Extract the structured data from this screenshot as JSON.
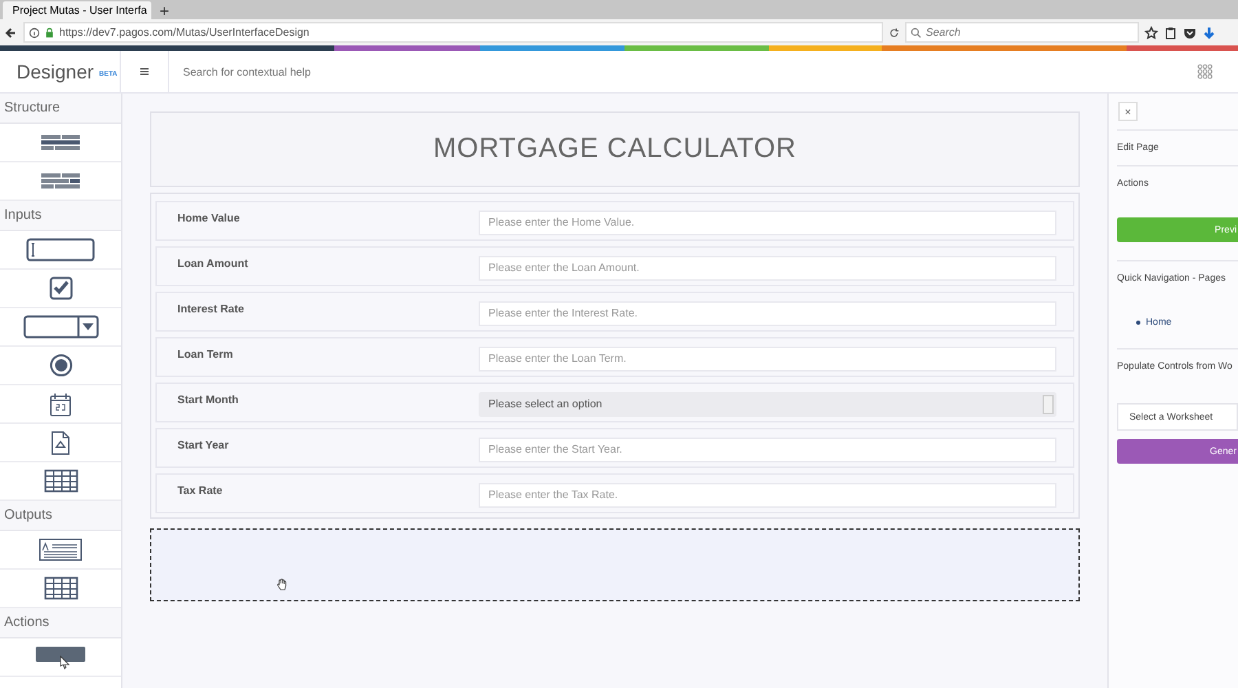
{
  "browser": {
    "tab_title": "Project Mutas - User Interfa",
    "new_tab": "+",
    "url": "https://dev7.pagos.com/Mutas/UserInterfaceDesign",
    "search": {
      "placeholder": "Search"
    }
  },
  "header": {
    "app_name": "Designer",
    "badge": "BETA",
    "help_search": {
      "placeholder": "Search for contextual help"
    }
  },
  "sidebar": {
    "sections": [
      {
        "title": "Structure",
        "items": [
          {
            "kind": "layout-a"
          },
          {
            "kind": "layout-b"
          }
        ]
      },
      {
        "title": "Inputs",
        "items": [
          {
            "kind": "textbox"
          },
          {
            "kind": "checkbox"
          },
          {
            "kind": "dropdown"
          },
          {
            "kind": "radio"
          },
          {
            "kind": "calendar"
          },
          {
            "kind": "file"
          },
          {
            "kind": "grid"
          }
        ]
      },
      {
        "title": "Outputs",
        "items": [
          {
            "kind": "text-output"
          },
          {
            "kind": "grid"
          }
        ]
      },
      {
        "title": "Actions",
        "items": [
          {
            "kind": "button"
          }
        ]
      }
    ]
  },
  "canvas": {
    "title": "MORTGAGE CALCULATOR",
    "fields": [
      {
        "label": "Home Value",
        "kind": "text",
        "placeholder": "Please enter the Home Value."
      },
      {
        "label": "Loan Amount",
        "kind": "text",
        "placeholder": "Please enter the Loan Amount."
      },
      {
        "label": "Interest Rate",
        "kind": "text",
        "placeholder": "Please enter the Interest Rate."
      },
      {
        "label": "Loan Term",
        "kind": "text",
        "placeholder": "Please enter the Loan Term."
      },
      {
        "label": "Start Month",
        "kind": "select",
        "value": "Please select an option"
      },
      {
        "label": "Start Year",
        "kind": "text",
        "placeholder": "Please enter the Start Year."
      },
      {
        "label": "Tax Rate",
        "kind": "text",
        "placeholder": "Please enter the Tax Rate."
      }
    ]
  },
  "right_panel": {
    "close": "×",
    "edit_page": "Edit Page",
    "actions_title": "Actions",
    "preview_button": "Previ",
    "quick_nav_title": "Quick Navigation - Pages",
    "pages": [
      "Home"
    ],
    "populate_title": "Populate Controls from Wo",
    "worksheet_select": "Select a Worksheet",
    "generate_button": "Gener"
  }
}
